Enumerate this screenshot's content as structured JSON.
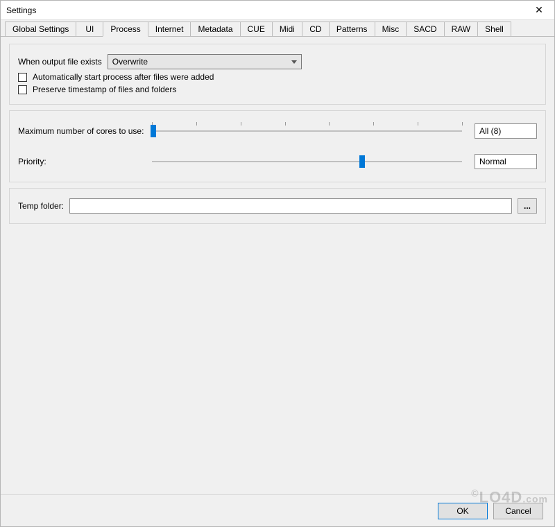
{
  "window": {
    "title": "Settings",
    "close_glyph": "✕"
  },
  "tabs": [
    {
      "label": "Global Settings",
      "active": false
    },
    {
      "label": "UI",
      "active": false
    },
    {
      "label": "Process",
      "active": true
    },
    {
      "label": "Internet",
      "active": false
    },
    {
      "label": "Metadata",
      "active": false
    },
    {
      "label": "CUE",
      "active": false
    },
    {
      "label": "Midi",
      "active": false
    },
    {
      "label": "CD",
      "active": false
    },
    {
      "label": "Patterns",
      "active": false
    },
    {
      "label": "Misc",
      "active": false
    },
    {
      "label": "SACD",
      "active": false
    },
    {
      "label": "RAW",
      "active": false
    },
    {
      "label": "Shell",
      "active": false
    }
  ],
  "output_exists": {
    "label": "When output file exists",
    "value": "Overwrite"
  },
  "checkboxes": {
    "auto_start": {
      "label": "Automatically start process after files were added",
      "checked": false
    },
    "preserve_ts": {
      "label": "Preserve timestamp of files and folders",
      "checked": false
    }
  },
  "cores": {
    "label": "Maximum number of cores to use:",
    "value": "All (8)",
    "slider_min": 1,
    "slider_max": 8,
    "slider_position_pct": 0
  },
  "priority": {
    "label": "Priority:",
    "value": "Normal",
    "slider_position_pct": 67
  },
  "temp": {
    "label": "Temp folder:",
    "value": "",
    "browse_label": "..."
  },
  "buttons": {
    "ok": "OK",
    "cancel": "Cancel"
  },
  "watermark": {
    "text": "LO4D",
    "suffix": ".com",
    "copy": "©"
  }
}
